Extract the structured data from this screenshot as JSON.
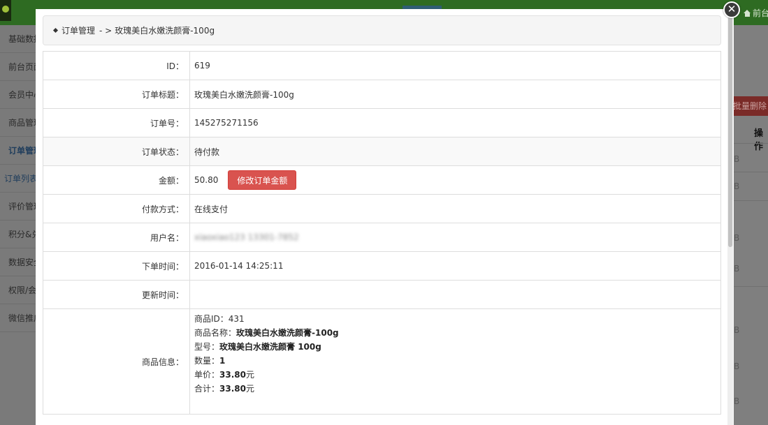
{
  "background": {
    "top_right_link": "前台",
    "sidebar_items": [
      "基础数据",
      "前台页面",
      "会员中心",
      "商品管理",
      "订单管理",
      "订单列表",
      "评价管理",
      "积分&兑换",
      "数据安全",
      "权限/会员",
      "微信推广"
    ],
    "batch_delete_label": "批量删除",
    "actions_header": "操作",
    "row_marker": "B"
  },
  "modal": {
    "close_symbol": "✕",
    "breadcrumb": {
      "section": "订单管理",
      "separator": "- >",
      "current": "玫瑰美白水嫩洗颜膏-100g"
    },
    "rows": [
      {
        "label": "ID：",
        "value": "619"
      },
      {
        "label": "订单标题：",
        "value": "玫瑰美白水嫩洗颜膏-100g"
      },
      {
        "label": "订单号：",
        "value": "145275271156"
      },
      {
        "label": "订单状态：",
        "value": "待付款"
      },
      {
        "label": "金额：",
        "value": "50.80",
        "button": "修改订单金额"
      },
      {
        "label": "付款方式：",
        "value": "在线支付"
      },
      {
        "label": "用户名：",
        "value": "xiaoxiao123 13301-7852"
      },
      {
        "label": "下单时间：",
        "value": "2016-01-14 14:25:11"
      },
      {
        "label": "更新时间：",
        "value": ""
      },
      {
        "label": "商品信息：",
        "product": {
          "id_label": "商品ID：",
          "id": "431",
          "name_label": "商品名称：",
          "name": "玫瑰美白水嫩洗颜膏-100g",
          "model_label": "型号：",
          "model": "玫瑰美白水嫩洗颜膏 100g",
          "qty_label": "数量：",
          "qty": "1",
          "price_label": "单价：",
          "price": "33.80",
          "price_unit": "元",
          "total_label": "合计：",
          "total": "33.80",
          "total_unit": "元"
        }
      }
    ]
  }
}
